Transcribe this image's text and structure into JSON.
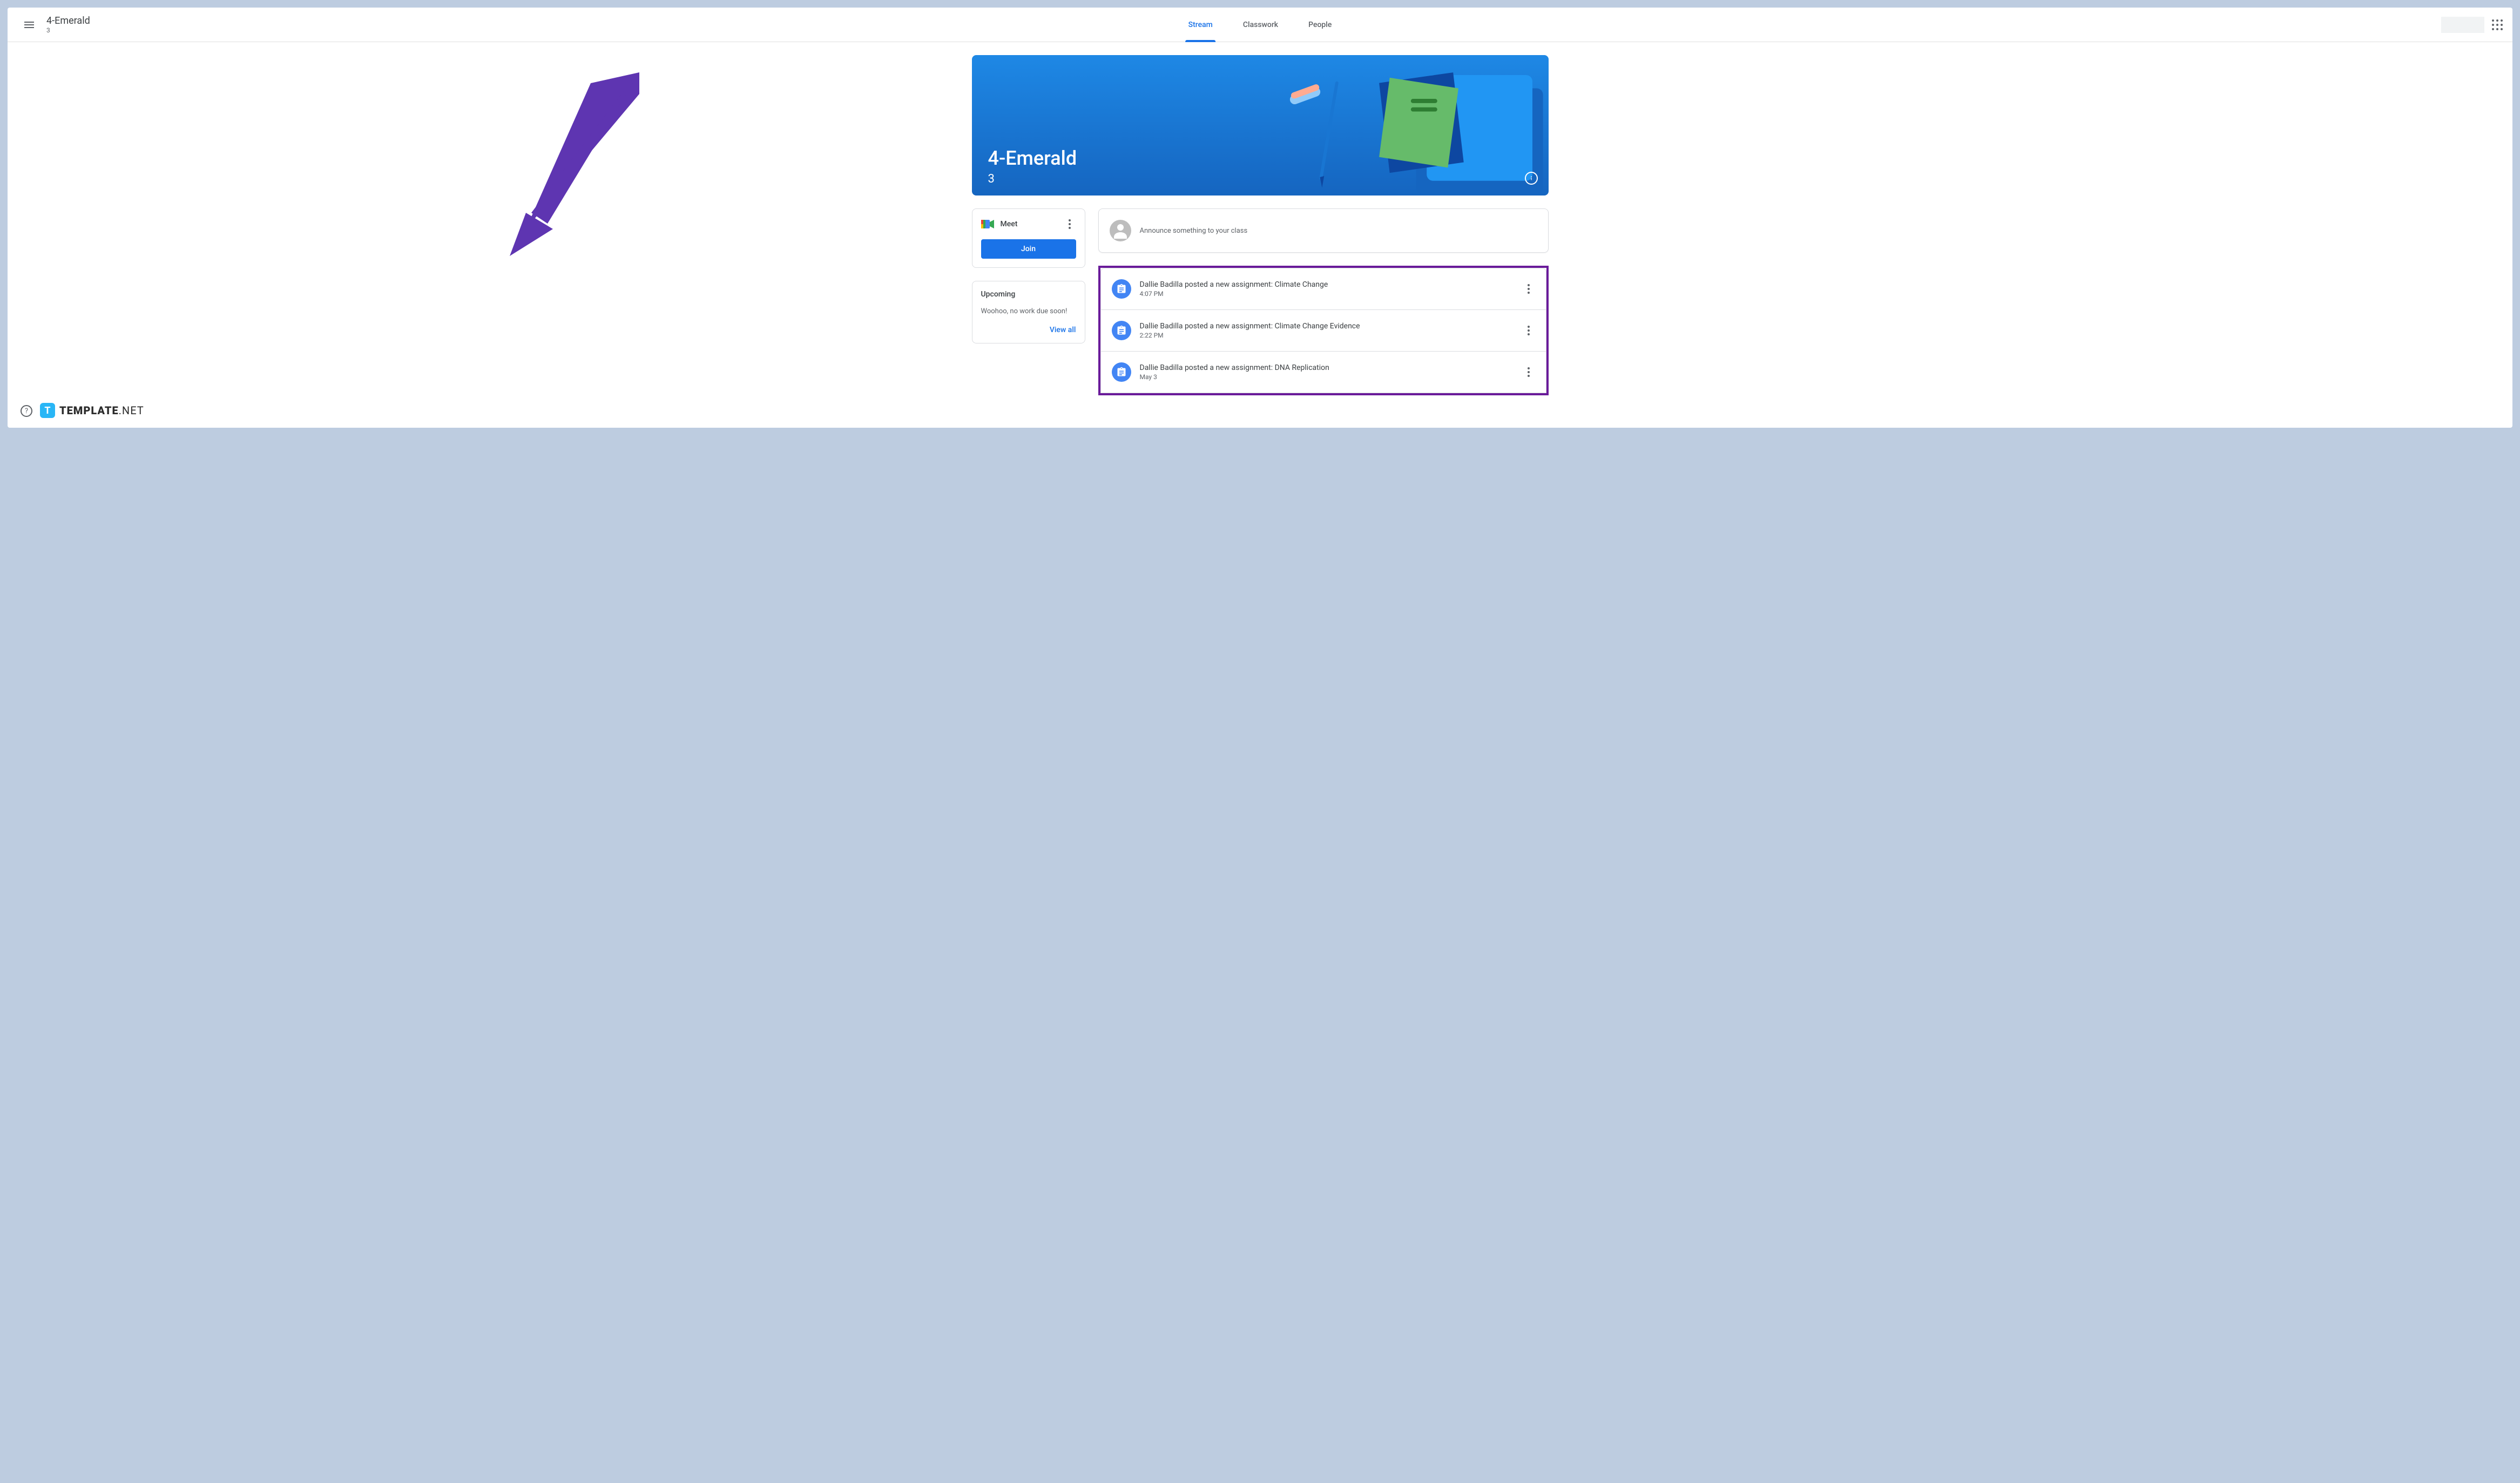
{
  "header": {
    "class_title": "4-Emerald",
    "class_sub": "3"
  },
  "tabs": {
    "stream": "Stream",
    "classwork": "Classwork",
    "people": "People"
  },
  "banner": {
    "title": "4-Emerald",
    "sub": "3"
  },
  "meet": {
    "label": "Meet",
    "join": "Join"
  },
  "upcoming": {
    "title": "Upcoming",
    "text": "Woohoo, no work due soon!",
    "view_all": "View all"
  },
  "announce": {
    "placeholder": "Announce something to your class"
  },
  "posts": [
    {
      "title": "Dallie Badilla posted a new assignment: Climate Change",
      "time": "4:07 PM"
    },
    {
      "title": "Dallie Badilla posted a new assignment: Climate Change Evidence",
      "time": "2:22 PM"
    },
    {
      "title": "Dallie Badilla posted a new assignment: DNA Replication",
      "time": "May 3"
    }
  ],
  "brand": {
    "icon_letter": "T",
    "name_bold": "TEMPLATE",
    "name_light": ".NET"
  }
}
